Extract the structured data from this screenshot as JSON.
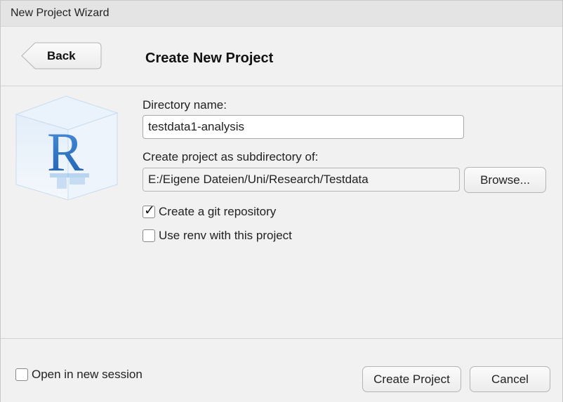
{
  "window": {
    "title": "New Project Wizard"
  },
  "header": {
    "back_label": "Back",
    "title": "Create New Project"
  },
  "logo": {
    "icon": "r-logo-icon",
    "letter": "R"
  },
  "form": {
    "directory_label": "Directory name:",
    "directory_value": "testdata1-analysis",
    "subdir_label": "Create project as subdirectory of:",
    "subdir_value": "E:/Eigene Dateien/Uni/Research/Testdata",
    "browse_label": "Browse...",
    "git": {
      "label": "Create a git repository",
      "checked": true
    },
    "renv": {
      "label": "Use renv with this project",
      "checked": false
    }
  },
  "footer": {
    "new_session": {
      "label": "Open in new session",
      "checked": false
    },
    "create_label": "Create Project",
    "cancel_label": "Cancel"
  },
  "colors": {
    "logo_blue": "#2b72c2",
    "cube_face": "#dcebf8"
  }
}
